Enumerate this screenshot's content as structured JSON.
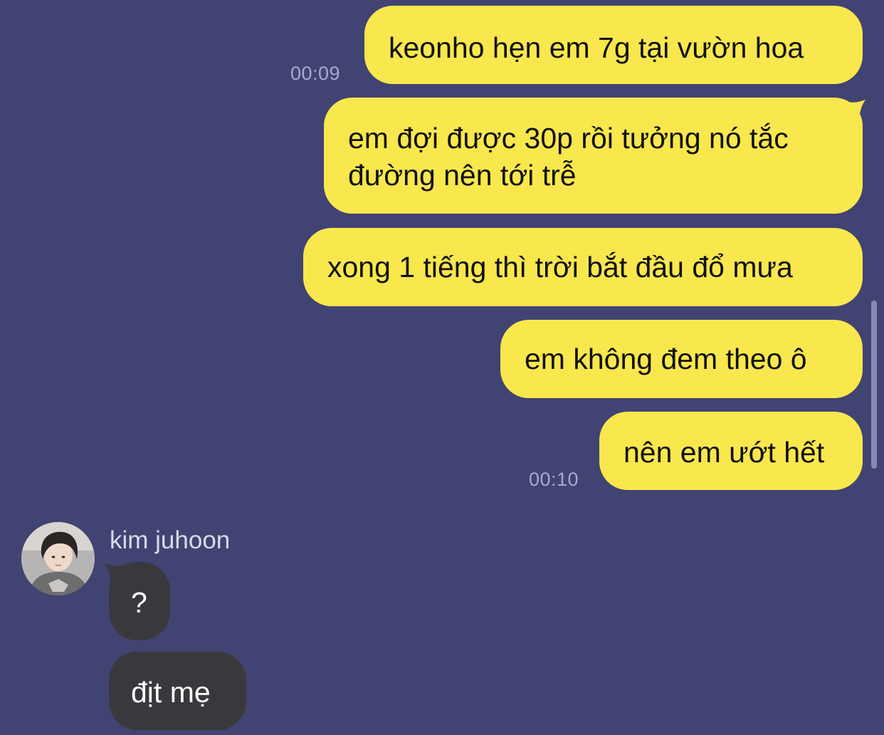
{
  "messages_out": [
    {
      "text": "keonho hẹn em 7g tại vườn hoa"
    },
    {
      "line1": "em đợi được 30p rồi tưởng nó tắc",
      "line2": "đường nên tới trễ"
    },
    {
      "text": "xong 1 tiếng thì trời bắt đầu đổ mưa"
    },
    {
      "text": "em không đem theo ô"
    },
    {
      "text": "nên em ướt hết"
    }
  ],
  "timestamps": [
    "00:09",
    "00:10"
  ],
  "contact": {
    "name": "kim juhoon",
    "avatar_icon": "profile-photo-avatar"
  },
  "messages_in": [
    {
      "text": "?"
    },
    {
      "text": "địt mẹ"
    }
  ],
  "colors": {
    "background": "#414372",
    "outgoing_bubble": "#f9e74e",
    "incoming_bubble": "#39393d",
    "timestamp": "#a8aacb"
  }
}
